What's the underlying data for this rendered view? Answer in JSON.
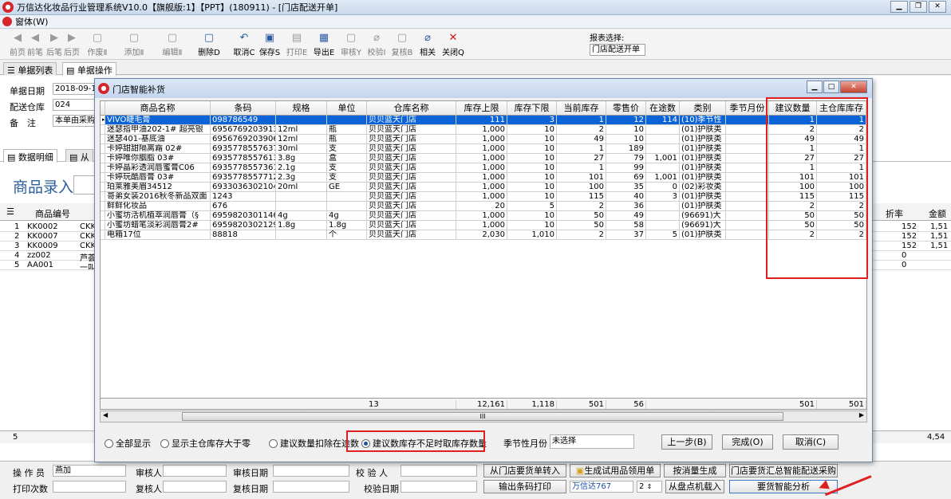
{
  "window": {
    "title": "万信达化妆品行业管理系统V10.0【旗舰版:1】【PPT】(180911) - [门店配送开单]",
    "menu": [
      "窗体(W)"
    ]
  },
  "toolbar": {
    "buttons": [
      {
        "label": "前页",
        "icon": "first-page-icon",
        "glyph": "◀"
      },
      {
        "label": "前笔",
        "icon": "prev-icon",
        "glyph": "◀"
      },
      {
        "label": "后笔",
        "icon": "next-icon",
        "glyph": "▶"
      },
      {
        "label": "后页",
        "icon": "last-page-icon",
        "glyph": "▶"
      },
      {
        "label": "作废Ⅱ",
        "icon": "void-icon",
        "glyph": "▢"
      },
      {
        "label": "添加Ⅱ",
        "icon": "add-icon",
        "glyph": "▢"
      },
      {
        "label": "编辑Ⅱ",
        "icon": "edit-icon",
        "glyph": "▢"
      },
      {
        "label": "删除D",
        "icon": "delete-icon",
        "glyph": "▢"
      },
      {
        "label": "取消C",
        "icon": "undo-icon",
        "glyph": "↶"
      },
      {
        "label": "保存S",
        "icon": "save-icon",
        "glyph": "▣"
      },
      {
        "label": "打印E",
        "icon": "print-icon",
        "glyph": "▤"
      },
      {
        "label": "导出E",
        "icon": "export-icon",
        "glyph": "▦"
      },
      {
        "label": "审核Y",
        "icon": "audit-icon",
        "glyph": "▢"
      },
      {
        "label": "校验I",
        "icon": "verify-icon",
        "glyph": "⌀"
      },
      {
        "label": "复核B",
        "icon": "recheck-icon",
        "glyph": "▢"
      },
      {
        "label": "相关",
        "icon": "link-icon",
        "glyph": "⌀"
      },
      {
        "label": "关闭Q",
        "icon": "close-icon",
        "glyph": "✕"
      }
    ],
    "report_label": "报表选择:",
    "report_value": "门店配送开单"
  },
  "tabs": [
    {
      "label": "单据列表"
    },
    {
      "label": "单据操作"
    }
  ],
  "form": {
    "date_label": "单据日期",
    "date_value": "2018-09-1",
    "warehouse_label": "配送仓库",
    "warehouse_value": "024",
    "note_label": "备　注",
    "note_value": "本单由采购"
  },
  "subtabs": [
    {
      "label": "数据明细"
    },
    {
      "label": "从"
    }
  ],
  "goods_entry_title": "商品录入",
  "bg_grid": {
    "headers": {
      "code": "商品编号",
      "discount": "折率",
      "amount": "金额"
    },
    "rows": [
      {
        "no": "1",
        "code": "KK0002",
        "c2": "CKK",
        "disc": "152",
        "amt": "1,51"
      },
      {
        "no": "2",
        "code": "KK0007",
        "c2": "CKK",
        "disc": "152",
        "amt": "1,51"
      },
      {
        "no": "3",
        "code": "KK0009",
        "c2": "CKK",
        "disc": "152",
        "amt": "1,51"
      },
      {
        "no": "4",
        "code": "zz002",
        "c2": "芦荟",
        "disc": "0",
        "amt": ""
      },
      {
        "no": "5",
        "code": "AA001",
        "c2": "一叫",
        "disc": "0",
        "amt": ""
      }
    ],
    "footer_no": "5",
    "footer_amount": "4,54"
  },
  "dialog": {
    "title": "门店智能补货",
    "headers": [
      "商品名称",
      "条码",
      "规格",
      "单位",
      "仓库名称",
      "库存上限",
      "库存下限",
      "当前库存",
      "零售价",
      "在途数",
      "类别",
      "季节月份",
      "建议数量",
      "主仓库库存"
    ],
    "rows": [
      [
        "VIVO睫毛膏",
        "098786549",
        "",
        "",
        "贝贝蓝天门店",
        "111",
        "3",
        "1",
        "12",
        "114",
        "(10)季节性",
        "",
        "1",
        "1"
      ],
      [
        "迷瑟指甲油202-1# 超亮银",
        "6956769203913",
        "12ml",
        "瓶",
        "贝贝蓝天门店",
        "1,000",
        "10",
        "2",
        "10",
        "",
        "(01)护肤类",
        "",
        "2",
        "2"
      ],
      [
        "迷瑟401-基底油",
        "6956769203906",
        "12ml",
        "瓶",
        "贝贝蓝天门店",
        "1,000",
        "10",
        "49",
        "10",
        "",
        "(01)护肤类",
        "",
        "49",
        "49"
      ],
      [
        "卡婷甜甜隔离霜 02#",
        "6935778557637",
        "30ml",
        "支",
        "贝贝蓝天门店",
        "1,000",
        "10",
        "1",
        "189",
        "",
        "(01)护肤类",
        "",
        "1",
        "1"
      ],
      [
        "卡婷唯你胭脂 03#",
        "6935778557613",
        "3.8g",
        "盒",
        "贝贝蓝天门店",
        "1,000",
        "10",
        "27",
        "79",
        "1,001",
        "(01)护肤类",
        "",
        "27",
        "27"
      ],
      [
        "卡婷晶彩透润唇蜜膏C06",
        "6935778557361",
        "2.1g",
        "支",
        "贝贝蓝天门店",
        "1,000",
        "10",
        "1",
        "99",
        "",
        "(01)护肤类",
        "",
        "1",
        "1"
      ],
      [
        "卡婷玩酷唇膏 03#",
        "6935778557712",
        "2.3g",
        "支",
        "贝贝蓝天门店",
        "1,000",
        "10",
        "101",
        "69",
        "1,001",
        "(01)护肤类",
        "",
        "101",
        "101"
      ],
      [
        "珀莱雅美眉34512",
        "6933036302104",
        "20ml",
        "GE",
        "贝贝蓝天门店",
        "1,000",
        "10",
        "100",
        "35",
        "0",
        "(02)彩妆类",
        "",
        "100",
        "100"
      ],
      [
        "哥弟女装2016秋冬新品双面",
        "1243",
        "",
        "",
        "贝贝蓝天门店",
        "1,000",
        "10",
        "115",
        "40",
        "3",
        "(01)护肤类",
        "",
        "115",
        "115"
      ],
      [
        "鲜鲜化妆品",
        "676",
        "",
        "",
        "贝贝蓝天门店",
        "20",
        "5",
        "2",
        "36",
        "",
        "(01)护肤类",
        "",
        "2",
        "2"
      ],
      [
        "小蜜坊活机植萃润唇膏（§",
        "6959820301146",
        "4g",
        "4g",
        "贝贝蓝天门店",
        "1,000",
        "10",
        "50",
        "49",
        "",
        "(96691)大",
        "",
        "50",
        "50"
      ],
      [
        "小蜜坊蜡笔淡彩润唇膏2#",
        "6959820302129",
        "1.8g",
        "1.8g",
        "贝贝蓝天门店",
        "1,000",
        "10",
        "50",
        "58",
        "",
        "(96691)大",
        "",
        "50",
        "50"
      ],
      [
        "电箱17位",
        "88818",
        "",
        "个",
        "贝贝蓝天门店",
        "2,030",
        "1,010",
        "2",
        "37",
        "5",
        "(01)护肤类",
        "",
        "2",
        "2"
      ]
    ],
    "footer": {
      "count": "13",
      "upper": "12,161",
      "lower": "1,118",
      "stock": "501",
      "price": "56",
      "suggest": "501",
      "main": "501"
    },
    "scroll_mark": "III",
    "options": [
      {
        "label": "全部显示",
        "selected": false
      },
      {
        "label": "显示主仓库存大于零",
        "selected": false
      },
      {
        "label": "建议数量扣除在途数",
        "selected": false
      },
      {
        "label": "建议数库存不足时取库存数量",
        "selected": true
      }
    ],
    "season_label": "季节性月份",
    "season_value": "未选择",
    "btn_prev": "上一步(B)",
    "btn_finish": "完成(O)",
    "btn_cancel": "取消(C)"
  },
  "bottom": {
    "operator_label": "操 作 员",
    "operator_value": "燕加",
    "auditor_label": "审核人",
    "audit_date_label": "审核日期",
    "verifier_label": "校 验 人",
    "print_count_label": "打印次数",
    "rechecker_label": "复核人",
    "recheck_date_label": "复核日期",
    "verify_date_label": "校验日期",
    "btn_store_req": "从门店要货单转入",
    "btn_trial": "生成试用品领用单",
    "btn_sales_gen": "按消量生成",
    "btn_store_summary": "门店要货汇总智能配送采购",
    "btn_barcode": "输出条码打印",
    "brand_link": "万信达767",
    "stepper_value": "2",
    "btn_inventory": "从盘点机载入",
    "btn_smart_analysis": "要货智能分析"
  },
  "colors": {
    "highlight": "#e02020",
    "selection": "#0a64d8",
    "title_blue": "#2a5d9a"
  }
}
